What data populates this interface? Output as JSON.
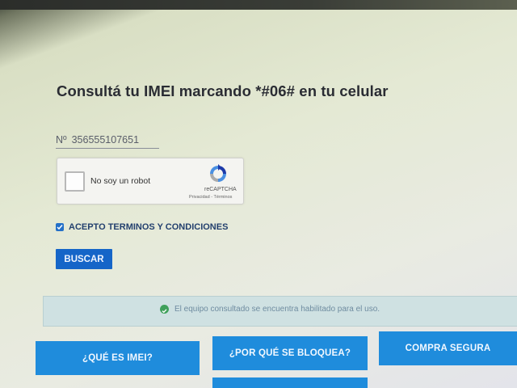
{
  "page": {
    "title": "Consultá tu IMEI marcando *#06# en tu celular"
  },
  "imei_field": {
    "prefix": "Nº",
    "value": "356555107651"
  },
  "recaptcha": {
    "label": "No soy un robot",
    "brand": "reCAPTCHA",
    "links": "Privacidad - Términos",
    "checked": false
  },
  "terms": {
    "label": "ACEPTO TERMINOS Y CONDICIONES",
    "checked": true
  },
  "search_button": {
    "label": "BUSCAR"
  },
  "status": {
    "message": "El equipo consultado se encuentra habilitado para el uso.",
    "icon": "check-circle-icon",
    "color": "#3fa05a"
  },
  "info_tiles": [
    {
      "label": "¿QUÉ ES IMEI?"
    },
    {
      "label": "¿POR QUÉ SE BLOQUEA?"
    },
    {
      "label": "COMPRA SEGURA"
    }
  ],
  "colors": {
    "primary": "#1565c8",
    "tile": "#1f8cdc",
    "status_background": "#cfe1e2"
  }
}
